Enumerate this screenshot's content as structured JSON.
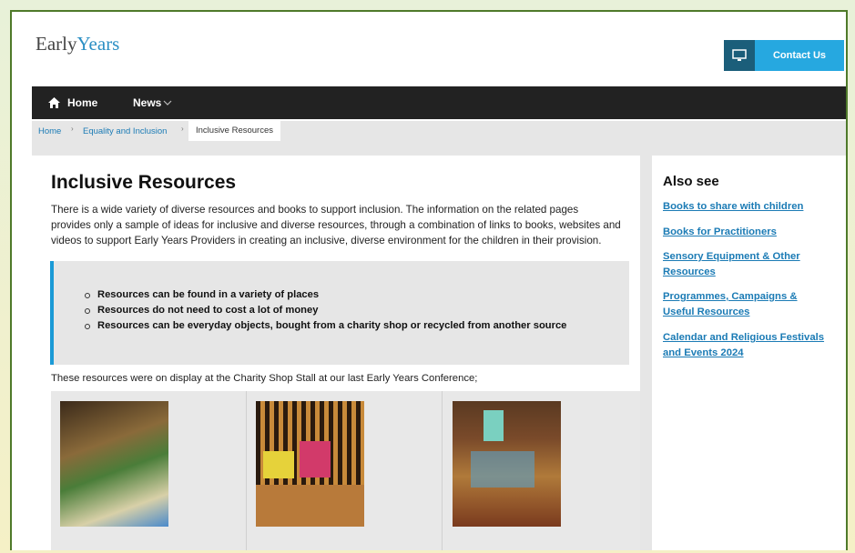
{
  "header": {
    "logo_part1": "Early",
    "logo_part2": "Years",
    "contact_label": "Contact Us",
    "contact_icon": "monitor-icon"
  },
  "nav": {
    "home_label": "Home",
    "home_icon": "home-icon",
    "news_label": "News",
    "news_icon": "chevron-down-icon"
  },
  "breadcrumb": {
    "items": [
      "Home",
      "Equality and Inclusion",
      "Inclusive Resources"
    ],
    "separator": "›"
  },
  "main": {
    "title": "Inclusive Resources",
    "intro": "There is a wide variety of diverse resources and books to support inclusion.  The information on the related pages provides only a sample of ideas for inclusive and diverse resources, through a combination of links to books, websites and videos to support Early Years Providers in creating an inclusive, diverse environment for the children in their provision.",
    "callout_items": [
      "Resources can be found in a variety of places",
      "Resources do not need to cost a lot of money",
      "Resources can be everyday objects, bought from a charity shop or recycled from another source"
    ],
    "caption": "These resources were on display at the Charity Shop Stall at our last Early Years Conference;"
  },
  "sidebar": {
    "title": "Also see",
    "links": [
      "Books to share with children",
      "Books for Practitioners",
      "Sensory Equipment & Other Resources",
      "Programmes, Campaigns & Useful Resources",
      "Calendar and Religious Festivals and Events 2024"
    ]
  },
  "colors": {
    "accent": "#26a8e0",
    "nav_bg": "#222222",
    "link": "#1b7bb5",
    "frame": "#4f7a2a"
  }
}
